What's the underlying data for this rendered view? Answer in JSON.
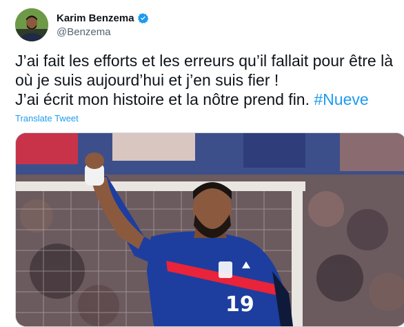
{
  "author": {
    "display_name": "Karim Benzema",
    "handle": "@Benzema",
    "verified": true
  },
  "tweet": {
    "line1": "J’ai fait les efforts et les erreurs qu’il fallait pour être là",
    "line2": "où je suis aujourd’hui et j’en suis fier !",
    "line3_text": "J’ai écrit mon histoire et la nôtre prend fin. ",
    "hashtag": "#Nueve",
    "translate_label": "Translate Tweet"
  },
  "media": {
    "jersey_number": "19"
  },
  "colors": {
    "link": "#1d9bf0",
    "jersey_blue": "#1d3e9e",
    "jersey_stripe": "#e8233a"
  }
}
